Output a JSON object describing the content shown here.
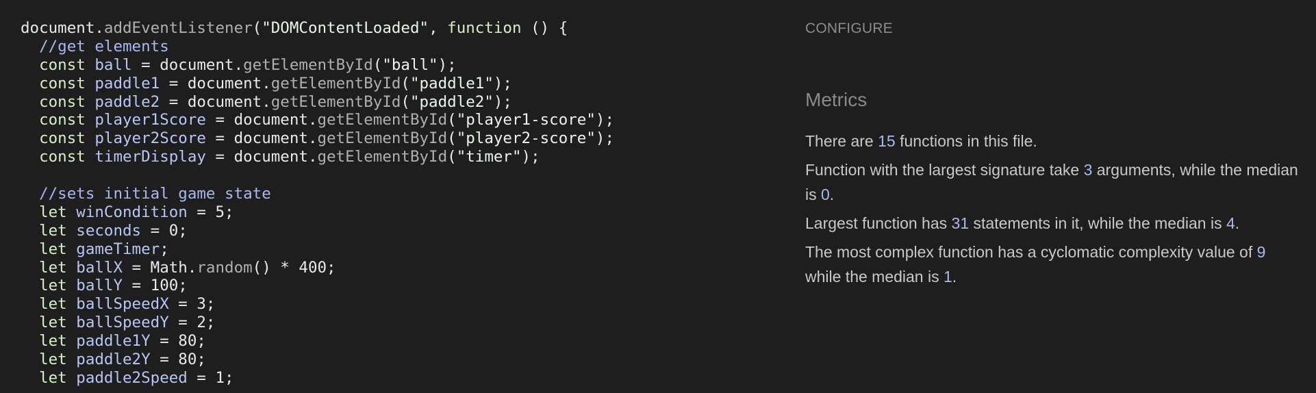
{
  "code": {
    "lines": [
      [
        [
          "plain",
          "document"
        ],
        [
          "plain",
          "."
        ],
        [
          "method",
          "addEventListener"
        ],
        [
          "plain",
          "("
        ],
        [
          "string",
          "\"DOMContentLoaded\""
        ],
        [
          "plain",
          ", "
        ],
        [
          "keyword",
          "function"
        ],
        [
          "plain",
          " () {"
        ]
      ],
      [
        [
          "plain",
          "  "
        ],
        [
          "comment",
          "//get elements"
        ]
      ],
      [
        [
          "plain",
          "  "
        ],
        [
          "keyword",
          "const"
        ],
        [
          "plain",
          " "
        ],
        [
          "var",
          "ball"
        ],
        [
          "plain",
          " = document."
        ],
        [
          "method",
          "getElementById"
        ],
        [
          "plain",
          "("
        ],
        [
          "string",
          "\"ball\""
        ],
        [
          "plain",
          ");"
        ]
      ],
      [
        [
          "plain",
          "  "
        ],
        [
          "keyword",
          "const"
        ],
        [
          "plain",
          " "
        ],
        [
          "var",
          "paddle1"
        ],
        [
          "plain",
          " = document."
        ],
        [
          "method",
          "getElementById"
        ],
        [
          "plain",
          "("
        ],
        [
          "string",
          "\"paddle1\""
        ],
        [
          "plain",
          ");"
        ]
      ],
      [
        [
          "plain",
          "  "
        ],
        [
          "keyword",
          "const"
        ],
        [
          "plain",
          " "
        ],
        [
          "var",
          "paddle2"
        ],
        [
          "plain",
          " = document."
        ],
        [
          "method",
          "getElementById"
        ],
        [
          "plain",
          "("
        ],
        [
          "string",
          "\"paddle2\""
        ],
        [
          "plain",
          ");"
        ]
      ],
      [
        [
          "plain",
          "  "
        ],
        [
          "keyword",
          "const"
        ],
        [
          "plain",
          " "
        ],
        [
          "var",
          "player1Score"
        ],
        [
          "plain",
          " = document."
        ],
        [
          "method",
          "getElementById"
        ],
        [
          "plain",
          "("
        ],
        [
          "string",
          "\"player1-score\""
        ],
        [
          "plain",
          ");"
        ]
      ],
      [
        [
          "plain",
          "  "
        ],
        [
          "keyword",
          "const"
        ],
        [
          "plain",
          " "
        ],
        [
          "var",
          "player2Score"
        ],
        [
          "plain",
          " = document."
        ],
        [
          "method",
          "getElementById"
        ],
        [
          "plain",
          "("
        ],
        [
          "string",
          "\"player2-score\""
        ],
        [
          "plain",
          ");"
        ]
      ],
      [
        [
          "plain",
          "  "
        ],
        [
          "keyword",
          "const"
        ],
        [
          "plain",
          " "
        ],
        [
          "var",
          "timerDisplay"
        ],
        [
          "plain",
          " = document."
        ],
        [
          "method",
          "getElementById"
        ],
        [
          "plain",
          "("
        ],
        [
          "string",
          "\"timer\""
        ],
        [
          "plain",
          ");"
        ]
      ],
      [
        [
          "plain",
          " "
        ]
      ],
      [
        [
          "plain",
          "  "
        ],
        [
          "comment",
          "//sets initial game state"
        ]
      ],
      [
        [
          "plain",
          "  "
        ],
        [
          "keyword",
          "let"
        ],
        [
          "plain",
          " "
        ],
        [
          "var",
          "winCondition"
        ],
        [
          "plain",
          " = 5;"
        ]
      ],
      [
        [
          "plain",
          "  "
        ],
        [
          "keyword",
          "let"
        ],
        [
          "plain",
          " "
        ],
        [
          "var",
          "seconds"
        ],
        [
          "plain",
          " = 0;"
        ]
      ],
      [
        [
          "plain",
          "  "
        ],
        [
          "keyword",
          "let"
        ],
        [
          "plain",
          " "
        ],
        [
          "var",
          "gameTimer"
        ],
        [
          "plain",
          ";"
        ]
      ],
      [
        [
          "plain",
          "  "
        ],
        [
          "keyword",
          "let"
        ],
        [
          "plain",
          " "
        ],
        [
          "var",
          "ballX"
        ],
        [
          "plain",
          " = Math."
        ],
        [
          "method",
          "random"
        ],
        [
          "plain",
          "() * 400;"
        ]
      ],
      [
        [
          "plain",
          "  "
        ],
        [
          "keyword",
          "let"
        ],
        [
          "plain",
          " "
        ],
        [
          "var",
          "ballY"
        ],
        [
          "plain",
          " = 100;"
        ]
      ],
      [
        [
          "plain",
          "  "
        ],
        [
          "keyword",
          "let"
        ],
        [
          "plain",
          " "
        ],
        [
          "var",
          "ballSpeedX"
        ],
        [
          "plain",
          " = 3;"
        ]
      ],
      [
        [
          "plain",
          "  "
        ],
        [
          "keyword",
          "let"
        ],
        [
          "plain",
          " "
        ],
        [
          "var",
          "ballSpeedY"
        ],
        [
          "plain",
          " = 2;"
        ]
      ],
      [
        [
          "plain",
          "  "
        ],
        [
          "keyword",
          "let"
        ],
        [
          "plain",
          " "
        ],
        [
          "var",
          "paddle1Y"
        ],
        [
          "plain",
          " = 80;"
        ]
      ],
      [
        [
          "plain",
          "  "
        ],
        [
          "keyword",
          "let"
        ],
        [
          "plain",
          " "
        ],
        [
          "var",
          "paddle2Y"
        ],
        [
          "plain",
          " = 80;"
        ]
      ],
      [
        [
          "plain",
          "  "
        ],
        [
          "keyword",
          "let"
        ],
        [
          "plain",
          " "
        ],
        [
          "var",
          "paddle2Speed"
        ],
        [
          "plain",
          " = 1;"
        ]
      ]
    ]
  },
  "configure_label": "CONFIGURE",
  "metrics": {
    "title": "Metrics",
    "paragraphs": [
      [
        [
          "t",
          "There are "
        ],
        [
          "n",
          "15"
        ],
        [
          "t",
          " functions in this file."
        ]
      ],
      [
        [
          "t",
          "Function with the largest signature take "
        ],
        [
          "n",
          "3"
        ],
        [
          "t",
          " arguments, while the median is "
        ],
        [
          "n",
          "0"
        ],
        [
          "t",
          "."
        ]
      ],
      [
        [
          "t",
          "Largest function has "
        ],
        [
          "n",
          "31"
        ],
        [
          "t",
          " statements in it, while the median is "
        ],
        [
          "n",
          "4"
        ],
        [
          "t",
          "."
        ]
      ],
      [
        [
          "t",
          "The most complex function has a cyclomatic complexity value of "
        ],
        [
          "n",
          "9"
        ],
        [
          "t",
          " while the median is "
        ],
        [
          "n",
          "1"
        ],
        [
          "t",
          "."
        ]
      ]
    ]
  },
  "colors": {
    "background": "#1e1e1e",
    "comment": "#a9b9ef",
    "keyword": "#d7efc5",
    "variable": "#b7c6f4",
    "metric_number": "#a9b9ef"
  }
}
